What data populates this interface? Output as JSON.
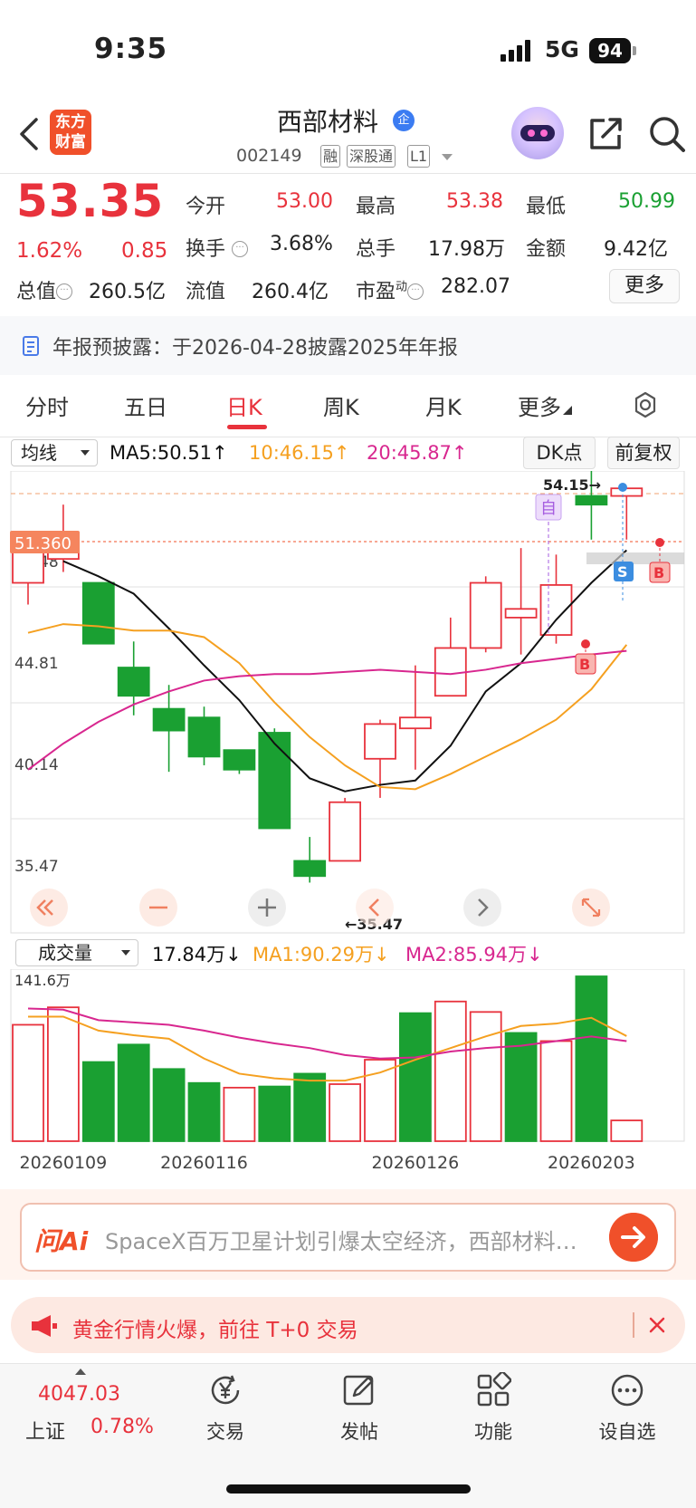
{
  "status_bar": {
    "time": "9:35",
    "network": "5G",
    "battery": "94"
  },
  "header": {
    "logo_line1": "东方",
    "logo_line2": "财富",
    "stock_name": "西部材料",
    "stock_badge": "企",
    "stock_code": "002149",
    "tags": [
      "融",
      "深股通",
      "L1"
    ]
  },
  "quote": {
    "price": "53.35",
    "change_pct": "1.62%",
    "change": "0.85",
    "stats": [
      {
        "label": "今开",
        "value": "53.00",
        "color": "#e8323c"
      },
      {
        "label": "最高",
        "value": "53.38",
        "color": "#e8323c"
      },
      {
        "label": "最低",
        "value": "50.99",
        "color": "#1aa032"
      },
      {
        "label": "换手",
        "value": "3.68%",
        "color": "#222222"
      },
      {
        "label": "总手",
        "value": "17.98万",
        "color": "#222222"
      },
      {
        "label": "金额",
        "value": "9.42亿",
        "color": "#222222"
      },
      {
        "label": "总值",
        "value": "260.5亿",
        "color": "#222222"
      },
      {
        "label": "流值",
        "value": "260.4亿",
        "color": "#222222"
      },
      {
        "label": "市盈",
        "label_sup": "动",
        "value": "282.07",
        "color": "#222222"
      }
    ],
    "more_label": "更多"
  },
  "notice": {
    "text": "年报预披露：于2026-04-28披露2025年年报"
  },
  "tabs": [
    {
      "label": "分时",
      "active": false
    },
    {
      "label": "五日",
      "active": false
    },
    {
      "label": "日K",
      "active": true
    },
    {
      "label": "周K",
      "active": false
    },
    {
      "label": "月K",
      "active": false
    },
    {
      "label": "更多",
      "active": false
    }
  ],
  "ma_bar": {
    "selector": "均线",
    "ma5": "MA5:50.51",
    "ma10": "10:46.15",
    "ma20": "20:45.87",
    "dk_label": "DK点",
    "adjust_label": "前复权"
  },
  "chart_data": [
    {
      "type": "candlestick",
      "title": "",
      "y_ticks": [
        "54.15",
        "49.48",
        "44.81",
        "40.14",
        "35.47"
      ],
      "ylim": [
        35.47,
        54.15
      ],
      "cursor_price": "51.360",
      "annotations": {
        "max_label": "54.15→",
        "min_label": "←35.47",
        "self_marker": "自",
        "buy_marker": "B",
        "sell_marker": "S"
      },
      "candles": [
        {
          "open": 49.0,
          "close": 50.6,
          "high": 51.1,
          "low": 48.0
        },
        {
          "open": 50.1,
          "close": 51.2,
          "high": 52.6,
          "low": 49.5
        },
        {
          "open": 49.0,
          "close": 46.2,
          "high": 49.0,
          "low": 46.2
        },
        {
          "open": 45.1,
          "close": 43.8,
          "high": 46.3,
          "low": 42.9
        },
        {
          "open": 43.2,
          "close": 42.2,
          "high": 44.3,
          "low": 40.3
        },
        {
          "open": 42.8,
          "close": 41.0,
          "high": 43.3,
          "low": 40.6
        },
        {
          "open": 41.3,
          "close": 40.4,
          "high": 41.3,
          "low": 40.2
        },
        {
          "open": 42.1,
          "close": 37.7,
          "high": 42.3,
          "low": 37.7
        },
        {
          "open": 36.2,
          "close": 35.5,
          "high": 37.3,
          "low": 35.2
        },
        {
          "open": 36.2,
          "close": 38.9,
          "high": 39.1,
          "low": 36.2
        },
        {
          "open": 40.9,
          "close": 42.5,
          "high": 42.7,
          "low": 39.1
        },
        {
          "open": 42.3,
          "close": 42.8,
          "high": 45.2,
          "low": 40.4
        },
        {
          "open": 43.8,
          "close": 46.0,
          "high": 47.4,
          "low": 43.8
        },
        {
          "open": 46.0,
          "close": 49.0,
          "high": 49.3,
          "low": 45.8
        },
        {
          "open": 47.4,
          "close": 47.8,
          "high": 50.6,
          "low": 45.7
        },
        {
          "open": 46.6,
          "close": 48.9,
          "high": 50.3,
          "low": 46.2
        },
        {
          "open": 53.0,
          "close": 52.6,
          "high": 54.15,
          "low": 50.99
        },
        {
          "open": 53.0,
          "close": 53.35,
          "high": 53.38,
          "low": 50.99
        }
      ],
      "series": [
        {
          "name": "MA5",
          "color": "#111111",
          "values": [
            null,
            50.0,
            49.3,
            48.5,
            46.9,
            45.2,
            43.6,
            41.6,
            40.0,
            39.4,
            39.7,
            39.9,
            41.5,
            44.0,
            45.3,
            47.3,
            49.0,
            50.5
          ]
        },
        {
          "name": "MA10",
          "color": "#f5a020",
          "values": [
            46.7,
            47.1,
            47.0,
            46.8,
            46.8,
            46.5,
            45.3,
            43.5,
            41.9,
            40.6,
            39.6,
            39.5,
            40.2,
            41.0,
            41.8,
            42.7,
            44.1,
            46.15
          ]
        },
        {
          "name": "MA20",
          "color": "#d8278f",
          "values": [
            40.4,
            41.6,
            42.6,
            43.4,
            44.0,
            44.5,
            44.7,
            44.8,
            44.8,
            44.9,
            45.0,
            44.9,
            44.8,
            45.0,
            45.3,
            45.5,
            45.7,
            45.87
          ]
        }
      ]
    },
    {
      "type": "bar",
      "title": "成交量",
      "y_ticks": [
        "141.6万"
      ],
      "ylim": [
        0,
        141.6
      ],
      "x_labels": [
        "20260109",
        "20260116",
        "20260126",
        "20260203"
      ],
      "legend": {
        "vol": "17.84万",
        "ma1": "MA1:90.29万",
        "ma2": "MA2:85.94万"
      },
      "values": [
        100.0,
        115.0,
        68.0,
        83.0,
        62.0,
        50.0,
        46.0,
        47.0,
        58.0,
        49.0,
        70.0,
        110.0,
        120.0,
        111.0,
        93.0,
        86.0,
        141.6,
        17.84
      ],
      "up": [
        true,
        true,
        false,
        false,
        false,
        false,
        true,
        false,
        false,
        true,
        true,
        false,
        true,
        true,
        false,
        true,
        false,
        true
      ],
      "series": [
        {
          "name": "MA1",
          "color": "#f5a020",
          "values": [
            107,
            107,
            95,
            91,
            88,
            71,
            58,
            54,
            52,
            52,
            59,
            70,
            80,
            90,
            99,
            101,
            106,
            90.29
          ]
        },
        {
          "name": "MA2",
          "color": "#d8278f",
          "values": [
            114,
            113,
            104,
            102,
            100,
            95,
            89,
            84,
            80,
            74,
            71,
            72,
            77,
            80,
            82,
            86,
            90,
            85.94
          ]
        }
      ]
    }
  ],
  "ai_bar": {
    "logo": "问Ai",
    "text": "SpaceX百万卫星计划引爆太空经济，西部材料有何布局？"
  },
  "promo": {
    "text": "黄金行情火爆，前往 T+0 交易"
  },
  "bottom_nav": {
    "index_value": "4047.03",
    "index_name": "上证",
    "index_pct": "0.78%",
    "items": [
      "交易",
      "发帖",
      "功能",
      "设自选"
    ]
  }
}
